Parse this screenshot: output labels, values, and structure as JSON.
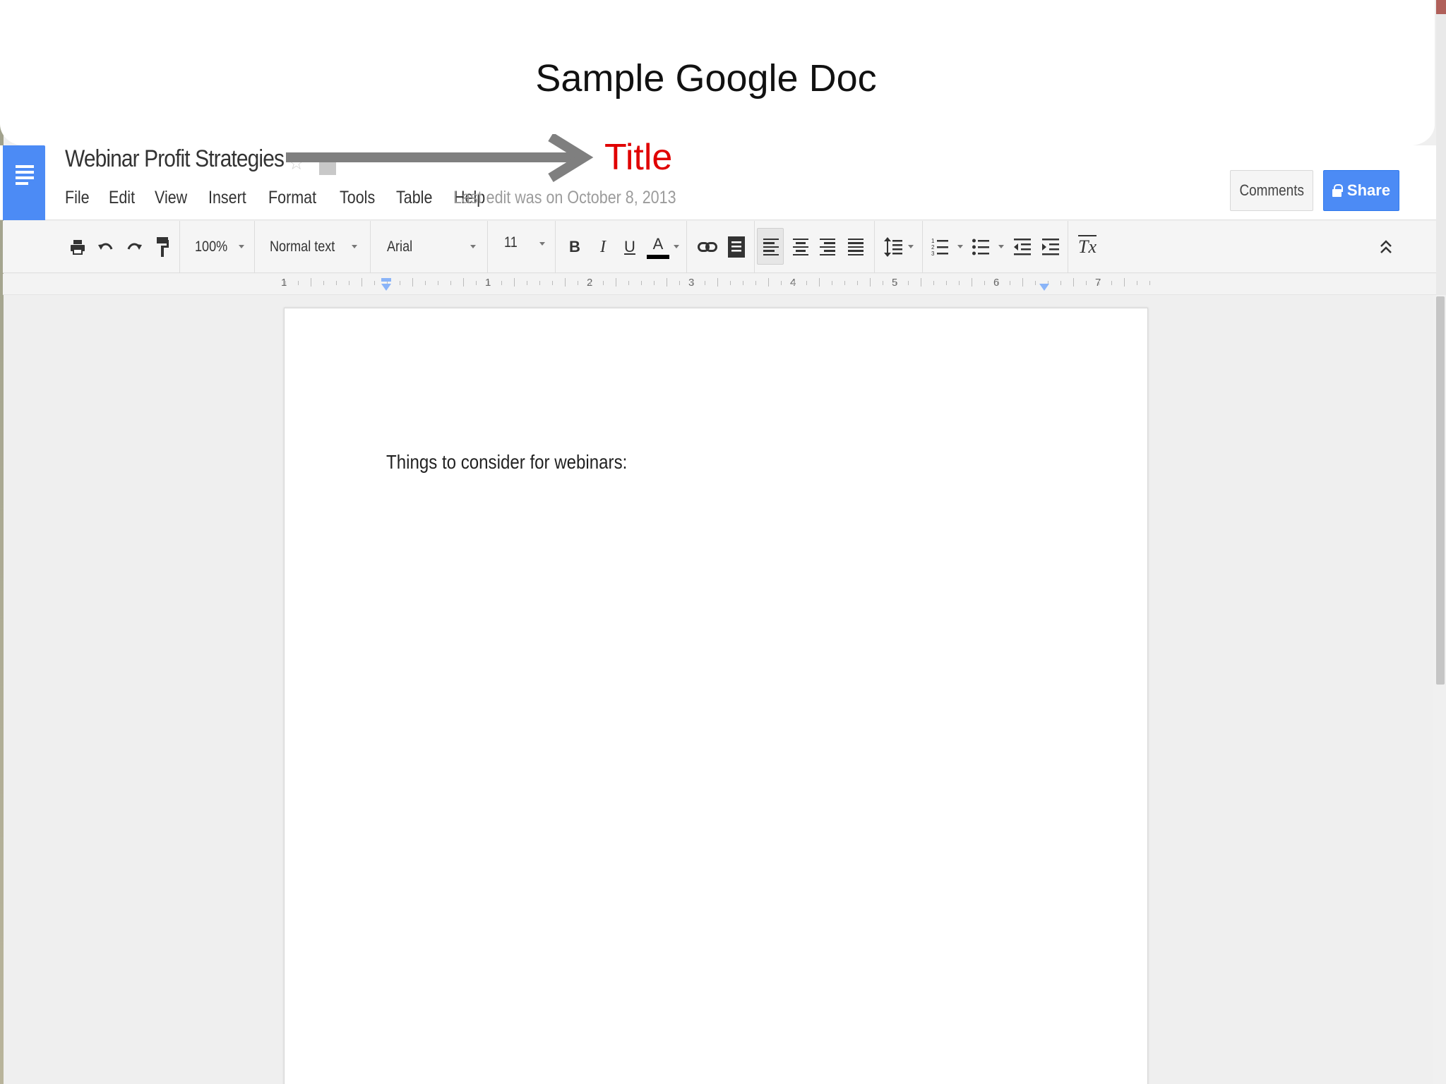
{
  "slide": {
    "title": "Sample Google Doc",
    "annotation_label": "Title",
    "annotation_color": "#e00000"
  },
  "doc": {
    "name": "Webinar Profit Strategies",
    "last_edit": "Last edit was on October 8, 2013",
    "menu": [
      "File",
      "Edit",
      "View",
      "Insert",
      "Format",
      "Tools",
      "Table",
      "Help"
    ],
    "comments_label": "Comments",
    "share_label": "Share",
    "accent_color": "#4c8bf5"
  },
  "toolbar": {
    "zoom": "100%",
    "style": "Normal text",
    "font": "Arial",
    "size": "11",
    "bold": "B",
    "italic": "I",
    "underline": "U",
    "text_color": "A",
    "clear_format": "Tx",
    "icons": [
      "print-icon",
      "undo-icon",
      "redo-icon",
      "paint-format-icon",
      "link-icon",
      "comment-icon",
      "align-left-icon",
      "align-center-icon",
      "align-right-icon",
      "align-justify-icon",
      "line-spacing-icon",
      "numbered-list-icon",
      "bulleted-list-icon",
      "decrease-indent-icon",
      "increase-indent-icon",
      "clear-formatting-icon",
      "collapse-icon"
    ]
  },
  "ruler": {
    "labels": [
      "1",
      "1",
      "2",
      "3",
      "4",
      "5",
      "6",
      "7"
    ]
  },
  "page": {
    "text": "Things to consider for webinars:"
  }
}
